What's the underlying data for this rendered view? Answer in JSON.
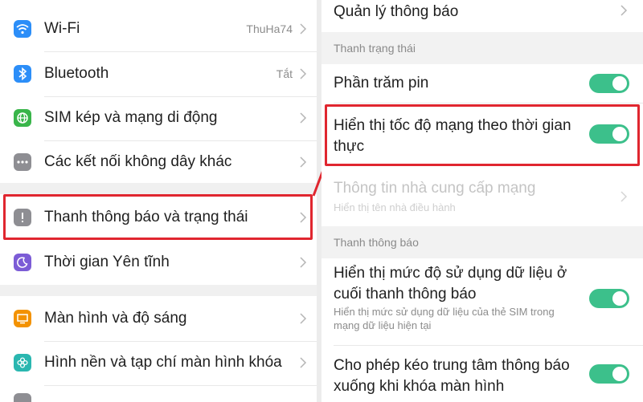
{
  "left": {
    "items": [
      {
        "label": "Wi-Fi",
        "value": "ThuHa74",
        "icon": "wifi-icon",
        "color": "#2c8ef8"
      },
      {
        "label": "Bluetooth",
        "value": "Tắt",
        "icon": "bluetooth-icon",
        "color": "#2c8ef8"
      },
      {
        "label": "SIM kép và mạng di động",
        "value": "",
        "icon": "globe-icon",
        "color": "#39b54a"
      },
      {
        "label": "Các kết nối không dây khác",
        "value": "",
        "icon": "more-icon",
        "color": "#8e8e93"
      },
      {
        "label": "Thanh thông báo và trạng thái",
        "value": "",
        "icon": "notification-icon",
        "color": "#8e8e93"
      },
      {
        "label": "Thời gian Yên tĩnh",
        "value": "",
        "icon": "moon-icon",
        "color": "#7c5cd6"
      },
      {
        "label": "Màn hình và độ sáng",
        "value": "",
        "icon": "display-icon",
        "color": "#f39200"
      },
      {
        "label": "Hình nền và tạp chí màn hình khóa",
        "value": "",
        "icon": "flower-icon",
        "color": "#2ab7b0"
      }
    ]
  },
  "right": {
    "top_item": "Quản lý thông báo",
    "section_status": "Thanh trạng thái",
    "battery_percent": "Phần trăm pin",
    "realtime_speed": "Hiển thị tốc độ mạng theo thời gian thực",
    "carrier_title": "Thông tin nhà cung cấp mạng",
    "carrier_sub": "Hiển thị tên nhà điều hành",
    "section_notif": "Thanh thông báo",
    "data_usage_title": "Hiển thị mức độ sử dụng dữ liệu ở cuối thanh thông báo",
    "data_usage_sub": "Hiển thị mức sử dụng dữ liệu của thẻ SIM trong mạng dữ liệu hiện tại",
    "pull_down_title": "Cho phép kéo trung tâm thông báo xuống khi khóa màn hình",
    "toggle_color": "#3cc08b",
    "highlight_color": "#e0262f"
  }
}
